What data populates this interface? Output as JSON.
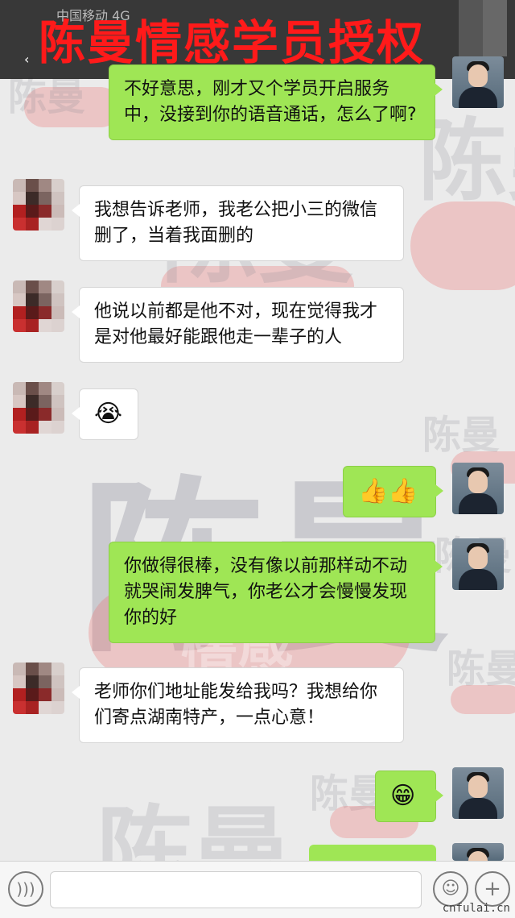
{
  "status_bar": {
    "carrier": "中国移动 4G"
  },
  "banner": {
    "title": "陈曼情感学员授权"
  },
  "watermark": {
    "brand": "陈曼",
    "sub": "情感"
  },
  "messages": [
    {
      "from": "self",
      "text": "不好意思，刚才又个学员开启服务中，没接到你的语音通话，怎么了啊?"
    },
    {
      "from": "other",
      "text": "我想告诉老师，我老公把小三的微信删了，当着我面删的"
    },
    {
      "from": "other",
      "text": "他说以前都是他不对，现在觉得我才是对他最好能跟他走一辈子的人"
    },
    {
      "from": "other",
      "text": "😭"
    },
    {
      "from": "self",
      "text": "👍👍"
    },
    {
      "from": "self",
      "text": "你做得很棒，没有像以前那样动不动就哭闹发脾气，你老公才会慢慢发现你的好"
    },
    {
      "from": "other",
      "text": "老师你们地址能发给我吗？我想给你们寄点湖南特产，一点心意！"
    },
    {
      "from": "self",
      "text": "😁"
    }
  ],
  "input_bar": {
    "voice_icon": "voice-icon",
    "emoji_icon": "smiley-icon",
    "plus_icon": "plus-icon",
    "placeholder": ""
  },
  "footer": {
    "site": "cnfulai.cn"
  },
  "colors": {
    "self_bubble": "#9fe655",
    "other_bubble": "#ffffff",
    "banner_text": "#ff1a1a",
    "background": "#ebebeb"
  }
}
